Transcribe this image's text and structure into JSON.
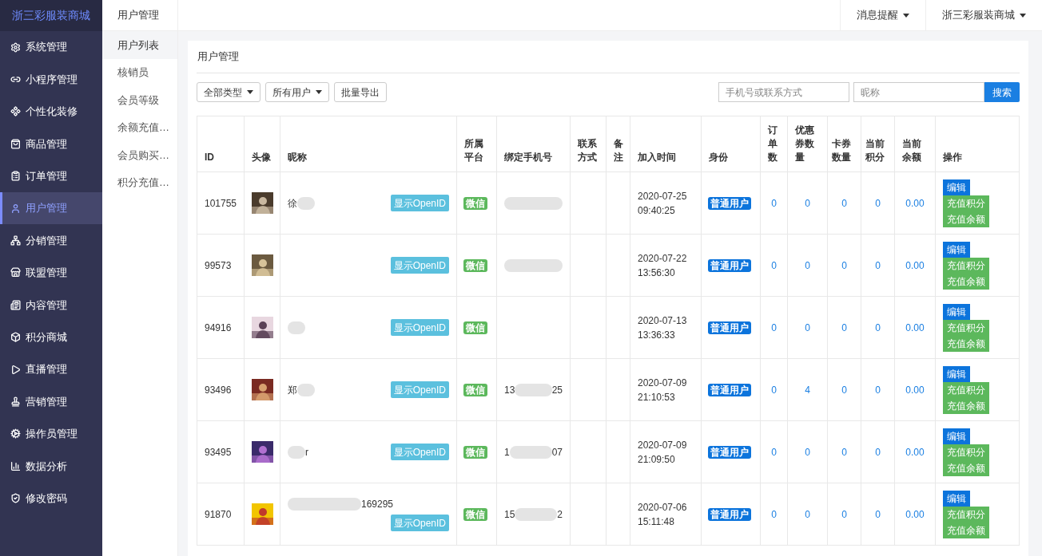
{
  "brand": "浙三彩服装商城",
  "sidebar": {
    "items": [
      {
        "label": "系统管理",
        "selected": false
      },
      {
        "label": "小程序管理",
        "selected": false
      },
      {
        "label": "个性化装修",
        "selected": false
      },
      {
        "label": "商品管理",
        "selected": false
      },
      {
        "label": "订单管理",
        "selected": false
      },
      {
        "label": "用户管理",
        "selected": true
      },
      {
        "label": "分销管理",
        "selected": false
      },
      {
        "label": "联盟管理",
        "selected": false
      },
      {
        "label": "内容管理",
        "selected": false
      },
      {
        "label": "积分商城",
        "selected": false
      },
      {
        "label": "直播管理",
        "selected": false
      },
      {
        "label": "营销管理",
        "selected": false
      },
      {
        "label": "操作员管理",
        "selected": false
      },
      {
        "label": "数据分析",
        "selected": false
      },
      {
        "label": "修改密码",
        "selected": false
      }
    ]
  },
  "submenu": {
    "title": "用户管理",
    "items": [
      {
        "label": "用户列表",
        "selected": true
      },
      {
        "label": "核销员",
        "selected": false
      },
      {
        "label": "会员等级",
        "selected": false
      },
      {
        "label": "余额充值…",
        "selected": false
      },
      {
        "label": "会员购买…",
        "selected": false
      },
      {
        "label": "积分充值…",
        "selected": false
      }
    ]
  },
  "topbar": {
    "menus": [
      "消息提醒",
      "浙三彩服装商城"
    ]
  },
  "card": {
    "title": "用户管理",
    "filters": [
      {
        "kind": "dropdown",
        "label": "全部类型"
      },
      {
        "kind": "dropdown",
        "label": "所有用户"
      },
      {
        "kind": "button",
        "label": "批量导出"
      }
    ],
    "search_fields": [
      {
        "placeholder": "手机号或联系方式"
      },
      {
        "placeholder": "昵称"
      }
    ],
    "search_button": "搜索",
    "table": {
      "columns": [
        "ID",
        "头像",
        "昵称",
        "所属平台",
        "绑定手机号",
        "联系方式",
        "备注",
        "加入时间",
        "身份",
        "订单数",
        "优惠券数量",
        "卡券数量",
        "当前积分",
        "当前余额",
        "操作"
      ],
      "rows": [
        {
          "id": "101755",
          "nickname": [
            {
              "kind": "text",
              "text": "徐"
            },
            {
              "kind": "blur"
            }
          ],
          "openid_button": "显示OpenID",
          "platform": "微信",
          "phone": [
            {
              "kind": "blur"
            }
          ],
          "join_time": "2020-07-25 09:40:25",
          "role": "普通用户",
          "orders": "0",
          "coupons": "0",
          "cards": "0",
          "points": "0",
          "balance": "0.00",
          "actions": [
            "编辑",
            "充值积分",
            "充值余额"
          ]
        },
        {
          "id": "99573",
          "nickname": [],
          "openid_button": "显示OpenID",
          "platform": "微信",
          "phone": [
            {
              "kind": "blur"
            }
          ],
          "join_time": "2020-07-22 13:56:30",
          "role": "普通用户",
          "orders": "0",
          "coupons": "0",
          "cards": "0",
          "points": "0",
          "balance": "0.00",
          "actions": [
            "编辑",
            "充值积分",
            "充值余额"
          ]
        },
        {
          "id": "94916",
          "nickname": [
            {
              "kind": "blur"
            }
          ],
          "openid_button": "显示OpenID",
          "platform": "微信",
          "phone": [],
          "join_time": "2020-07-13 13:36:33",
          "role": "普通用户",
          "orders": "0",
          "coupons": "0",
          "cards": "0",
          "points": "0",
          "balance": "0.00",
          "actions": [
            "编辑",
            "充值积分",
            "充值余额"
          ]
        },
        {
          "id": "93496",
          "nickname": [
            {
              "kind": "text",
              "text": "郑"
            },
            {
              "kind": "blur"
            }
          ],
          "openid_button": "显示OpenID",
          "platform": "微信",
          "phone": [
            {
              "kind": "text",
              "text": "13"
            },
            {
              "kind": "blur"
            },
            {
              "kind": "text",
              "text": "25"
            }
          ],
          "join_time": "2020-07-09 21:10:53",
          "role": "普通用户",
          "orders": "0",
          "coupons": "4",
          "cards": "0",
          "points": "0",
          "balance": "0.00",
          "actions": [
            "编辑",
            "充值积分",
            "充值余额"
          ]
        },
        {
          "id": "93495",
          "nickname": [
            {
              "kind": "blur"
            },
            {
              "kind": "text",
              "text": "r"
            }
          ],
          "openid_button": "显示OpenID",
          "platform": "微信",
          "phone": [
            {
              "kind": "text",
              "text": "1"
            },
            {
              "kind": "blur"
            },
            {
              "kind": "text",
              "text": "07"
            }
          ],
          "join_time": "2020-07-09 21:09:50",
          "role": "普通用户",
          "orders": "0",
          "coupons": "0",
          "cards": "0",
          "points": "0",
          "balance": "0.00",
          "actions": [
            "编辑",
            "充值积分",
            "充值余额"
          ]
        },
        {
          "id": "91870",
          "nickname": [
            {
              "kind": "blur"
            },
            {
              "kind": "text",
              "text": "169295"
            }
          ],
          "openid_button": "显示OpenID",
          "platform": "微信",
          "phone": [
            {
              "kind": "text",
              "text": "15"
            },
            {
              "kind": "blur"
            },
            {
              "kind": "text",
              "text": "2"
            }
          ],
          "join_time": "2020-07-06 15:11:48",
          "role": "普通用户",
          "orders": "0",
          "coupons": "0",
          "cards": "0",
          "points": "0",
          "balance": "0.00",
          "actions": [
            "编辑",
            "充值积分",
            "充值余额"
          ]
        }
      ]
    }
  }
}
